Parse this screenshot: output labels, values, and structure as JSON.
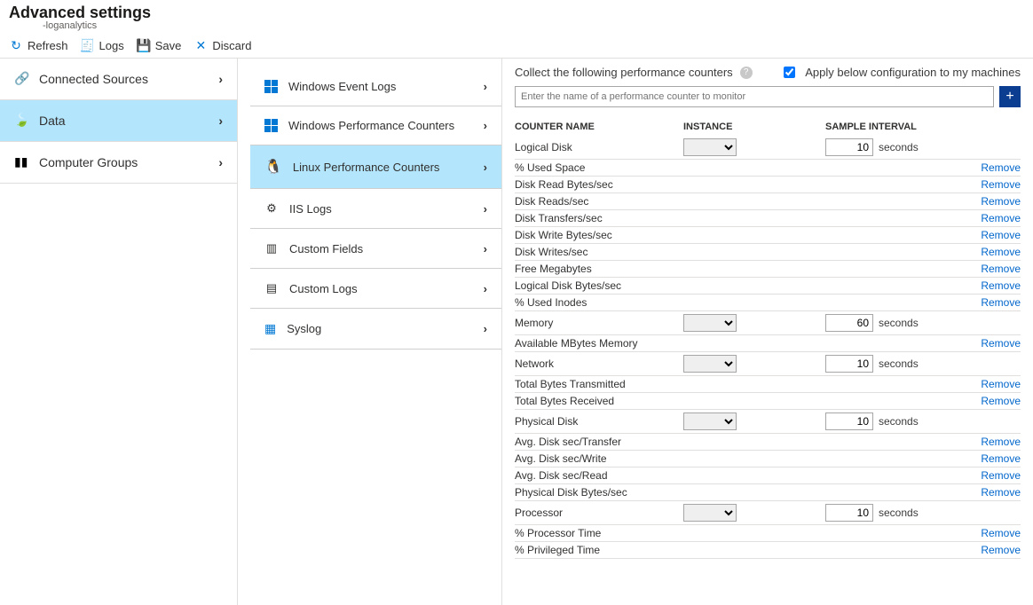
{
  "header": {
    "title": "Advanced settings",
    "subtitle": "-loganalytics"
  },
  "toolbar": {
    "refresh": "Refresh",
    "logs": "Logs",
    "save": "Save",
    "discard": "Discard"
  },
  "sidebar": {
    "items": [
      {
        "label": "Connected Sources"
      },
      {
        "label": "Data"
      },
      {
        "label": "Computer Groups"
      }
    ],
    "selected": 1
  },
  "categories": {
    "items": [
      {
        "label": "Windows Event Logs"
      },
      {
        "label": "Windows Performance Counters"
      },
      {
        "label": "Linux Performance Counters"
      },
      {
        "label": "IIS Logs"
      },
      {
        "label": "Custom Fields"
      },
      {
        "label": "Custom Logs"
      },
      {
        "label": "Syslog"
      }
    ],
    "selected": 2
  },
  "panel": {
    "collect_label": "Collect the following performance counters",
    "apply_label": "Apply below configuration to my machines",
    "apply_checked": true,
    "search_placeholder": "Enter the name of a performance counter to monitor",
    "col_counter": "COUNTER NAME",
    "col_instance": "INSTANCE",
    "col_interval": "SAMPLE INTERVAL",
    "seconds_label": "seconds",
    "remove_label": "Remove",
    "groups": [
      {
        "name": "Logical Disk",
        "interval": "10",
        "counters": [
          "% Used Space",
          "Disk Read Bytes/sec",
          "Disk Reads/sec",
          "Disk Transfers/sec",
          "Disk Write Bytes/sec",
          "Disk Writes/sec",
          "Free Megabytes",
          "Logical Disk Bytes/sec",
          "% Used Inodes"
        ]
      },
      {
        "name": "Memory",
        "interval": "60",
        "counters": [
          "Available MBytes Memory"
        ]
      },
      {
        "name": "Network",
        "interval": "10",
        "counters": [
          "Total Bytes Transmitted",
          "Total Bytes Received"
        ]
      },
      {
        "name": "Physical Disk",
        "interval": "10",
        "counters": [
          "Avg. Disk sec/Transfer",
          "Avg. Disk sec/Write",
          "Avg. Disk sec/Read",
          "Physical Disk Bytes/sec"
        ]
      },
      {
        "name": "Processor",
        "interval": "10",
        "counters": [
          "% Processor Time",
          "% Privileged Time"
        ]
      }
    ]
  }
}
